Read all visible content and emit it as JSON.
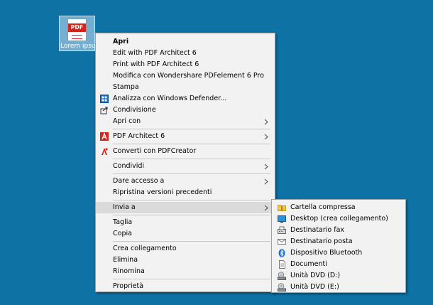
{
  "desktop": {
    "file_label": "Lorem ipsum",
    "file_badge": "PDF"
  },
  "menu": {
    "items": [
      {
        "label": "Apri"
      },
      {
        "label": "Edit with PDF Architect 6"
      },
      {
        "label": "Print with PDF Architect 6"
      },
      {
        "label": "Modifica con Wondershare PDFelement 6 Pro"
      },
      {
        "label": "Stampa"
      },
      {
        "label": "Analizza con Windows Defender...",
        "icon": "windows-defender-icon"
      },
      {
        "label": "Condivisione",
        "icon": "share-icon"
      },
      {
        "label": "Apri con",
        "submenu": true
      },
      {
        "label": "PDF Architect 6",
        "icon": "pdf-architect-icon",
        "submenu": true
      },
      {
        "label": "Converti con PDFCreator",
        "icon": "pdfcreator-icon"
      },
      {
        "label": "Condividi",
        "submenu": true
      },
      {
        "label": "Dare accesso a",
        "submenu": true
      },
      {
        "label": "Ripristina versioni precedenti"
      },
      {
        "label": "Invia a",
        "submenu": true
      },
      {
        "label": "Taglia"
      },
      {
        "label": "Copia"
      },
      {
        "label": "Crea collegamento"
      },
      {
        "label": "Elimina"
      },
      {
        "label": "Rinomina"
      },
      {
        "label": "Proprietà"
      }
    ]
  },
  "submenu": {
    "items": [
      {
        "label": "Cartella compressa",
        "icon": "zip-folder-icon"
      },
      {
        "label": "Desktop (crea collegamento)",
        "icon": "desktop-icon"
      },
      {
        "label": "Destinatario fax",
        "icon": "fax-icon"
      },
      {
        "label": "Destinatario posta",
        "icon": "mail-icon"
      },
      {
        "label": "Dispositivo Bluetooth",
        "icon": "bluetooth-icon"
      },
      {
        "label": "Documenti",
        "icon": "documents-icon"
      },
      {
        "label": "Unità DVD (D:)",
        "icon": "dvd-drive-icon"
      },
      {
        "label": "Unità DVD (E:)",
        "icon": "dvd-drive-icon"
      }
    ]
  },
  "colors": {
    "desktop_bg": "#0e72a5",
    "menu_bg": "#f2f2f2",
    "hover_bg": "#dadada",
    "pdf_red": "#d4261e"
  }
}
